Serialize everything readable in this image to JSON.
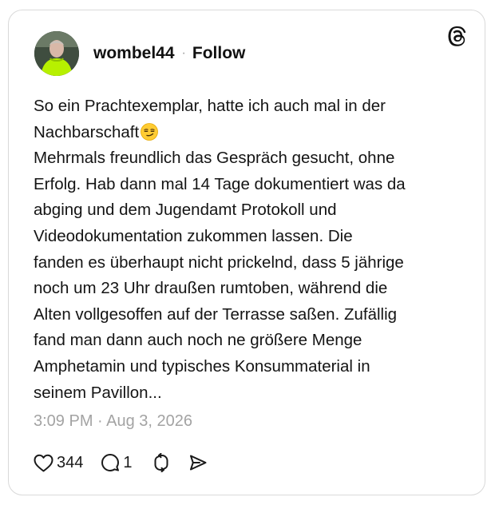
{
  "post": {
    "username": "wombel44",
    "separator": "·",
    "follow_label": "Follow",
    "text_line1": "So ein Prachtexemplar, hatte ich auch mal in der\nNachbarschaft",
    "text_rest": "Mehrmals freundlich das Gespräch gesucht, ohne\nErfolg. Hab dann mal 14 Tage dokumentiert was da\nabging und dem Jugendamt Protokoll und\nVideodokumentation zukommen lassen. Die\nfanden es überhaupt nicht prickelnd, dass 5 jährige\nnoch um 23 Uhr draußen rumtoben, während die\nAlten vollgesoffen auf der Terrasse saßen. Zufällig\nfand man dann auch noch ne größere Menge\nAmphetamin und typisches Konsummaterial in\nseinem Pavillon...",
    "timestamp": "3:09 PM · Aug 3, 2026",
    "emoji": "smirking-face"
  },
  "actions": {
    "like_count": "344",
    "reply_count": "1"
  },
  "icons": {
    "logo": "threads-logo-icon",
    "like": "heart-icon",
    "reply": "comment-icon",
    "repost": "repost-icon",
    "share": "send-icon"
  },
  "colors": {
    "text": "#141414",
    "muted": "#a3a3a3",
    "border": "#d9d9d9",
    "avatar_shirt": "#b7f000"
  }
}
